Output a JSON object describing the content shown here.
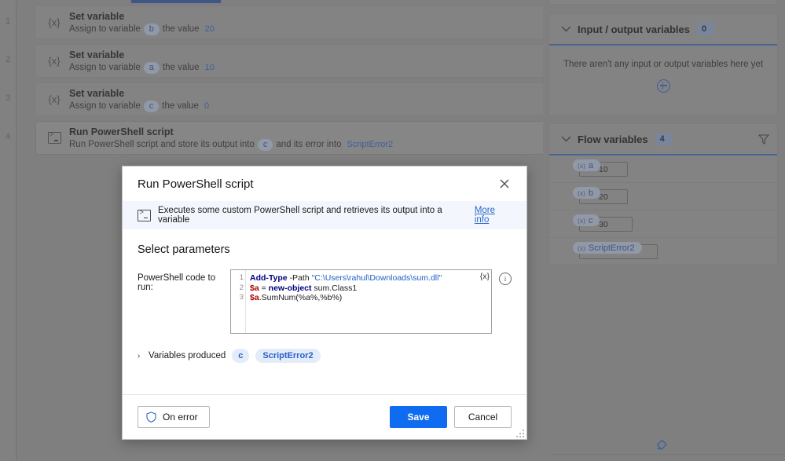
{
  "app": {
    "accent_blue": "#0f6cf1",
    "tab_indicator_color": "#2b50a8",
    "link_color": "#2a66c8"
  },
  "workspace": {
    "step_numbers": [
      "1",
      "2",
      "3",
      "4"
    ],
    "actions": [
      {
        "index": "1",
        "icon": "set-variable-icon",
        "icon_glyph": "{x}",
        "title": "Set variable",
        "desc_prefix": "Assign to variable",
        "variable": "b",
        "desc_middle": "the value",
        "value": "20",
        "selected": false
      },
      {
        "index": "2",
        "icon": "set-variable-icon",
        "icon_glyph": "{x}",
        "title": "Set variable",
        "desc_prefix": "Assign to variable",
        "variable": "a",
        "desc_middle": "the value",
        "value": "10",
        "selected": false
      },
      {
        "index": "3",
        "icon": "set-variable-icon",
        "icon_glyph": "{x}",
        "title": "Set variable",
        "desc_prefix": "Assign to variable",
        "variable": "c",
        "desc_middle": "the value",
        "value": "0",
        "selected": false
      }
    ],
    "powershell_action": {
      "index": "4",
      "icon": "powershell-icon",
      "title": "Run PowerShell script",
      "desc_prefix": "Run PowerShell script and store its output into",
      "output_variable": "c",
      "desc_middle": "and its error into",
      "error_variable": "ScriptError2",
      "menu_icon": "kebab-menu-icon"
    }
  },
  "variables_pane": {
    "input_output": {
      "title": "Input / output variables",
      "count": "0",
      "empty_message": "There aren't any input or output variables here yet",
      "add_icon": "plus-circle-icon",
      "collapse_icon": "chevron-down-icon"
    },
    "flow": {
      "title": "Flow variables",
      "count": "4",
      "collapse_icon": "chevron-down-icon",
      "filter_icon": "filter-icon",
      "items": [
        {
          "name": "a",
          "value": "10"
        },
        {
          "name": "b",
          "value": "20"
        },
        {
          "name": "c",
          "value": "30"
        },
        {
          "name": "ScriptError2",
          "value": ""
        }
      ]
    },
    "eraser_icon": "eraser-icon"
  },
  "dialog": {
    "title": "Run PowerShell script",
    "close_icon": "close-icon",
    "banner": {
      "icon": "powershell-icon",
      "text": "Executes some custom PowerShell script and retrieves its output into a variable",
      "link_label": "More info"
    },
    "section_title": "Select parameters",
    "code_field": {
      "label": "PowerShell code to run:",
      "variable_picker_glyph": "{x}",
      "variable_picker_icon": "variable-picker-icon",
      "info_icon": "info-icon",
      "info_glyph": "i",
      "line_numbers": [
        "1",
        "2",
        "3"
      ],
      "lines": [
        {
          "tokens": [
            {
              "t": "Add-Type",
              "c": "kw"
            },
            {
              "t": " -Path ",
              "c": "op"
            },
            {
              "t": "\"C:\\Users\\rahul\\Downloads\\sum.dll\"",
              "c": "str"
            }
          ]
        },
        {
          "tokens": [
            {
              "t": "$a",
              "c": "var"
            },
            {
              "t": " = ",
              "c": "op"
            },
            {
              "t": "new-object",
              "c": "kw"
            },
            {
              "t": " sum.Class1",
              "c": "op"
            }
          ]
        },
        {
          "tokens": [
            {
              "t": "$a",
              "c": "var"
            },
            {
              "t": ".SumNum(%a%,%b%)",
              "c": "op"
            }
          ]
        }
      ],
      "plain_text": "Add-Type -Path \"C:\\Users\\rahul\\Downloads\\sum.dll\"\n$a = new-object sum.Class1\n$a.SumNum(%a%,%b%)"
    },
    "variables_produced": {
      "label": "Variables produced",
      "expand_icon": "chevron-right-icon",
      "chips": [
        "c",
        "ScriptError2"
      ]
    },
    "footer": {
      "on_error_label": "On error",
      "on_error_icon": "shield-icon",
      "save_label": "Save",
      "cancel_label": "Cancel",
      "resize_icon": "resize-grip-icon"
    }
  }
}
